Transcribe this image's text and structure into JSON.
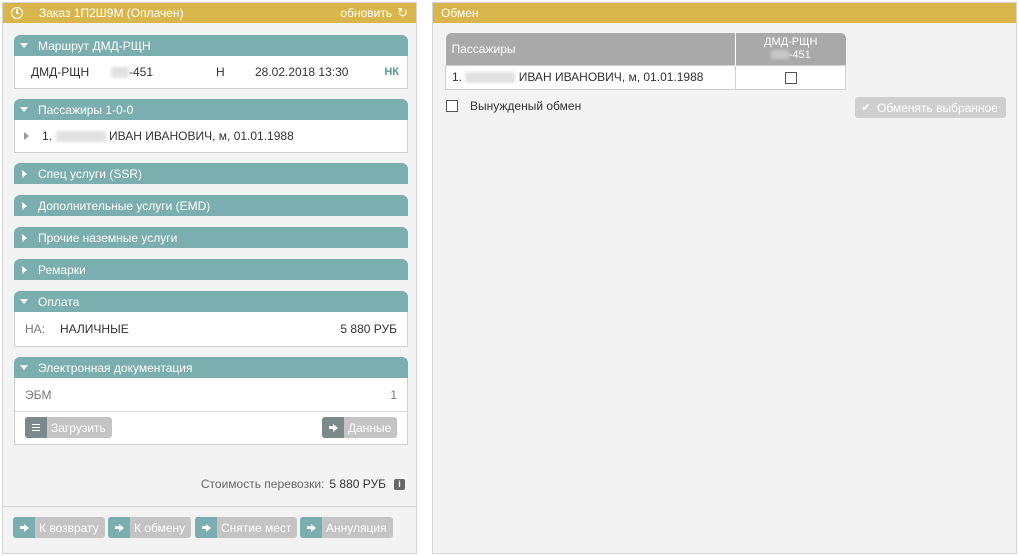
{
  "order": {
    "title": "Заказ 1П2Ш9М (Оплачен)",
    "refresh_label": "обновить"
  },
  "route": {
    "header": "Маршрут ДМД-РЩН",
    "segment": "ДМД-РЩН",
    "flight_suffix": "-451",
    "class": "Н",
    "datetime": "28.02.2018 13:30",
    "status": "НК"
  },
  "passengers": {
    "header": "Пассажиры 1-0-0",
    "items": [
      {
        "number": "1.",
        "name": "ИВАН ИВАНОВИЧ, м, 01.01.1988"
      }
    ]
  },
  "collapsed_sections": [
    "Спец услуги (SSR)",
    "Дополнительные услуги (EMD)",
    "Прочие наземные услуги",
    "Ремарки"
  ],
  "payment": {
    "header": "Оплата",
    "type_code": "НА:",
    "type_name": "НАЛИЧНЫЕ",
    "amount": "5 880 РУБ"
  },
  "edocs": {
    "header": "Электронная документация",
    "label": "ЭБМ",
    "count": "1",
    "upload_button": "Загрузить",
    "data_button": "Данные"
  },
  "total": {
    "label": "Стоимость перевозки:",
    "value": "5 880 РУБ"
  },
  "actions": {
    "refund": "К возврату",
    "exchange": "К обмену",
    "seat_release": "Снятие мест",
    "cancel": "Аннуляция"
  },
  "exchange_panel": {
    "title": "Обмен",
    "col_passengers": "Пассажиры",
    "col_segment": "ДМД-РЩН",
    "col_flight_suffix": "-451",
    "rows": [
      {
        "number": "1.",
        "name": "ИВАН ИВАНОВИЧ, м, 01.01.1988"
      }
    ],
    "forced_label": "Вынужденый обмен",
    "exchange_selected_button": "Обменять выбранное"
  },
  "colors": {
    "header_gold": "#d9b64b",
    "section_teal": "#7baeae",
    "button_gray": "#c4c4c4"
  }
}
